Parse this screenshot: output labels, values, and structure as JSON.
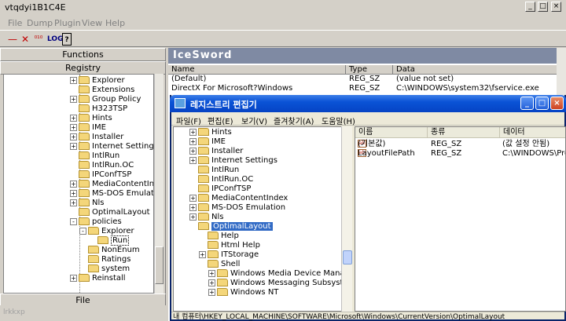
{
  "ice": {
    "title": "vtqdyi1B1C4E",
    "menu": [
      "File",
      "Dump",
      "Plugin",
      "View",
      "Help"
    ],
    "toolbar": [
      "—",
      "✕",
      "⁰¹⁰",
      "LOG",
      "?"
    ],
    "sections": {
      "functions": "Functions",
      "registry": "Registry",
      "file": "File"
    },
    "status_text": "lrkkxp",
    "brand": "IceSword",
    "list_headers": {
      "name": "Name",
      "type": "Type",
      "data": "Data"
    },
    "rows": [
      {
        "name": "(Default)",
        "type": "REG_SZ",
        "data": "(value not set)"
      },
      {
        "name": "DirectX For Microsoft?Windows",
        "type": "REG_SZ",
        "data": "C:\\WINDOWS\\system32\\fservice.exe"
      }
    ],
    "tree": [
      {
        "label": "Explorer",
        "level": 0,
        "expander": "+"
      },
      {
        "label": "Extensions",
        "level": 0,
        "expander": ""
      },
      {
        "label": "Group Policy",
        "level": 0,
        "expander": "+"
      },
      {
        "label": "H323TSP",
        "level": 0,
        "expander": ""
      },
      {
        "label": "Hints",
        "level": 0,
        "expander": "+"
      },
      {
        "label": "IME",
        "level": 0,
        "expander": "+"
      },
      {
        "label": "Installer",
        "level": 0,
        "expander": "+"
      },
      {
        "label": "Internet Settings",
        "level": 0,
        "expander": "+"
      },
      {
        "label": "IntlRun",
        "level": 0,
        "expander": ""
      },
      {
        "label": "IntlRun.OC",
        "level": 0,
        "expander": ""
      },
      {
        "label": "IPConfTSP",
        "level": 0,
        "expander": ""
      },
      {
        "label": "MediaContentIndex",
        "level": 0,
        "expander": "+"
      },
      {
        "label": "MS-DOS Emulation",
        "level": 0,
        "expander": "+"
      },
      {
        "label": "Nls",
        "level": 0,
        "expander": "+"
      },
      {
        "label": "OptimalLayout",
        "level": 0,
        "expander": ""
      },
      {
        "label": "policies",
        "level": 0,
        "expander": "-"
      },
      {
        "label": "Explorer",
        "level": 1,
        "expander": "-"
      },
      {
        "label": "Run",
        "level": 2,
        "expander": "",
        "selected": true
      },
      {
        "label": "NonEnum",
        "level": 1,
        "expander": ""
      },
      {
        "label": "Ratings",
        "level": 1,
        "expander": ""
      },
      {
        "label": "system",
        "level": 1,
        "expander": ""
      },
      {
        "label": "Reinstall",
        "level": 0,
        "expander": "+"
      }
    ]
  },
  "regedit": {
    "title": "레지스트리 편집기",
    "menu": [
      "파일(F)",
      "편집(E)",
      "보기(V)",
      "즐겨찾기(A)",
      "도움말(H)"
    ],
    "tree": [
      {
        "label": "Hints",
        "level": 2,
        "expander": "+"
      },
      {
        "label": "IME",
        "level": 2,
        "expander": "+"
      },
      {
        "label": "Installer",
        "level": 2,
        "expander": "+"
      },
      {
        "label": "Internet Settings",
        "level": 2,
        "expander": "+"
      },
      {
        "label": "IntlRun",
        "level": 2,
        "expander": ""
      },
      {
        "label": "IntlRun.OC",
        "level": 2,
        "expander": ""
      },
      {
        "label": "IPConfTSP",
        "level": 2,
        "expander": ""
      },
      {
        "label": "MediaContentIndex",
        "level": 2,
        "expander": "+"
      },
      {
        "label": "MS-DOS Emulation",
        "level": 2,
        "expander": "+"
      },
      {
        "label": "Nls",
        "level": 2,
        "expander": "+"
      },
      {
        "label": "OptimalLayout",
        "level": 2,
        "expander": "",
        "selected": true
      },
      {
        "label": "Help",
        "level": 1,
        "expander": ""
      },
      {
        "label": "Html Help",
        "level": 1,
        "expander": ""
      },
      {
        "label": "ITStorage",
        "level": 1,
        "expander": "+"
      },
      {
        "label": "Shell",
        "level": 1,
        "expander": ""
      },
      {
        "label": "Windows Media Device Manager",
        "level": 0,
        "expander": "+"
      },
      {
        "label": "Windows Messaging Subsystem",
        "level": 0,
        "expander": "+"
      },
      {
        "label": "Windows NT",
        "level": 0,
        "expander": "+"
      }
    ],
    "list_headers": {
      "name": "이름",
      "type": "종류",
      "data": "데이터"
    },
    "rows": [
      {
        "name": "(기본값)",
        "type": "REG_SZ",
        "data": "(값 설정 안됨)"
      },
      {
        "name": "LayoutFilePath",
        "type": "REG_SZ",
        "data": "C:\\WINDOWS\\Pre"
      }
    ],
    "status": "내 컴퓨터\\HKEY_LOCAL_MACHINE\\SOFTWARE\\Microsoft\\Windows\\CurrentVersion\\OptimalLayout"
  }
}
